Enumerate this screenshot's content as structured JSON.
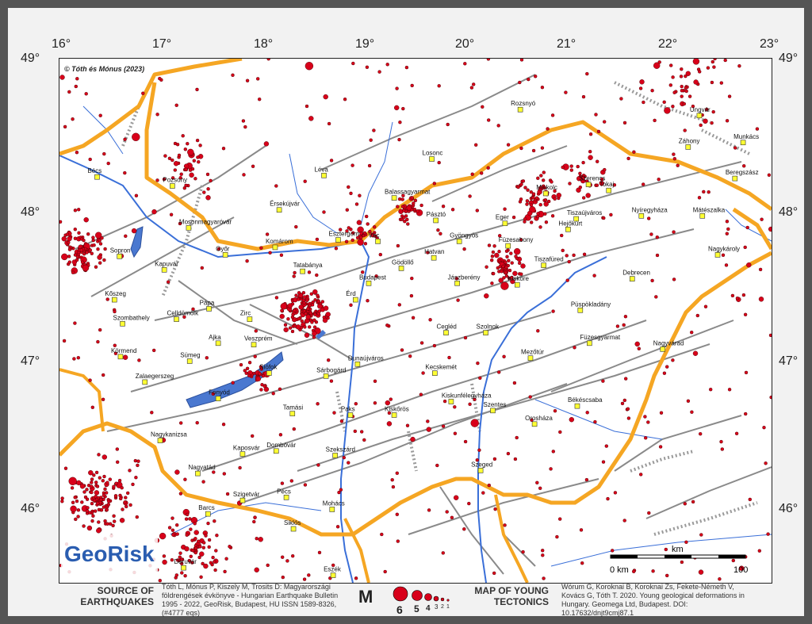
{
  "copyright": "© Tóth és Mónus (2023)",
  "lon_ticks": [
    "16°",
    "17°",
    "18°",
    "19°",
    "20°",
    "21°",
    "22°",
    "23°"
  ],
  "lat_ticks": [
    "49°",
    "48°",
    "47°",
    "46°"
  ],
  "logo": {
    "name": "GeoRisk",
    "tag": "Földrengéskutató Intézet • Earthquake Engineering • www.georisk.hu"
  },
  "towns": [
    {
      "name": "Rozsnyó",
      "lon": 20.53,
      "lat": 48.66
    },
    {
      "name": "Ungvár",
      "lon": 22.29,
      "lat": 48.62
    },
    {
      "name": "Losonc",
      "lon": 19.66,
      "lat": 48.33
    },
    {
      "name": "Munkács",
      "lon": 22.72,
      "lat": 48.44
    },
    {
      "name": "Záhony",
      "lon": 22.18,
      "lat": 48.41
    },
    {
      "name": "Léva",
      "lon": 18.6,
      "lat": 48.22
    },
    {
      "name": "Bécs",
      "lon": 16.37,
      "lat": 48.21
    },
    {
      "name": "Pozsony",
      "lon": 17.11,
      "lat": 48.15
    },
    {
      "name": "Szerencs",
      "lon": 21.2,
      "lat": 48.16
    },
    {
      "name": "Beregszász",
      "lon": 22.64,
      "lat": 48.2
    },
    {
      "name": "Balassagyarmat",
      "lon": 19.29,
      "lat": 48.07
    },
    {
      "name": "Miskolc",
      "lon": 20.78,
      "lat": 48.1
    },
    {
      "name": "Tokaj",
      "lon": 21.4,
      "lat": 48.12
    },
    {
      "name": "Érsekújvár",
      "lon": 18.16,
      "lat": 47.99
    },
    {
      "name": "Pásztó",
      "lon": 19.7,
      "lat": 47.92
    },
    {
      "name": "Eger",
      "lon": 20.38,
      "lat": 47.9
    },
    {
      "name": "Tiszaújváros",
      "lon": 21.08,
      "lat": 47.93
    },
    {
      "name": "Nyíregyháza",
      "lon": 21.72,
      "lat": 47.95
    },
    {
      "name": "Mátészalka",
      "lon": 22.32,
      "lat": 47.95
    },
    {
      "name": "Mosonmagyaróvár",
      "lon": 17.27,
      "lat": 47.87
    },
    {
      "name": "Hejőkürt",
      "lon": 21.0,
      "lat": 47.86
    },
    {
      "name": "Gyöngyös",
      "lon": 19.93,
      "lat": 47.78
    },
    {
      "name": "Füzesabony",
      "lon": 20.41,
      "lat": 47.75
    },
    {
      "name": "Esztergom",
      "lon": 18.74,
      "lat": 47.79
    },
    {
      "name": "Vác",
      "lon": 19.13,
      "lat": 47.78
    },
    {
      "name": "Győr",
      "lon": 17.63,
      "lat": 47.69
    },
    {
      "name": "Komárom",
      "lon": 18.12,
      "lat": 47.74
    },
    {
      "name": "Sopron",
      "lon": 16.59,
      "lat": 47.68
    },
    {
      "name": "Tatabánya",
      "lon": 18.39,
      "lat": 47.58
    },
    {
      "name": "Hatvan",
      "lon": 19.68,
      "lat": 47.67
    },
    {
      "name": "Tiszafüred",
      "lon": 20.76,
      "lat": 47.62
    },
    {
      "name": "Nagykároly",
      "lon": 22.47,
      "lat": 47.69
    },
    {
      "name": "Kapuvár",
      "lon": 17.03,
      "lat": 47.59
    },
    {
      "name": "Gödöllő",
      "lon": 19.36,
      "lat": 47.6
    },
    {
      "name": "Budapest",
      "lon": 19.04,
      "lat": 47.5
    },
    {
      "name": "Jászberény",
      "lon": 19.91,
      "lat": 47.5
    },
    {
      "name": "Kisköre",
      "lon": 20.5,
      "lat": 47.49
    },
    {
      "name": "Debrecen",
      "lon": 21.63,
      "lat": 47.53
    },
    {
      "name": "Kőszeg",
      "lon": 16.54,
      "lat": 47.39
    },
    {
      "name": "Pápa",
      "lon": 17.47,
      "lat": 47.33
    },
    {
      "name": "Zirc",
      "lon": 17.87,
      "lat": 47.26
    },
    {
      "name": "Celldömölk",
      "lon": 17.15,
      "lat": 47.26
    },
    {
      "name": "Püspökladány",
      "lon": 21.12,
      "lat": 47.32
    },
    {
      "name": "Érd",
      "lon": 18.91,
      "lat": 47.39
    },
    {
      "name": "Szombathely",
      "lon": 16.62,
      "lat": 47.23
    },
    {
      "name": "Ajka",
      "lon": 17.56,
      "lat": 47.1
    },
    {
      "name": "Cegléd",
      "lon": 19.8,
      "lat": 47.17
    },
    {
      "name": "Szolnok",
      "lon": 20.19,
      "lat": 47.17
    },
    {
      "name": "Füzesgyarmat",
      "lon": 21.21,
      "lat": 47.1
    },
    {
      "name": "Veszprém",
      "lon": 17.91,
      "lat": 47.09
    },
    {
      "name": "Körmend",
      "lon": 16.6,
      "lat": 47.01
    },
    {
      "name": "Sümeg",
      "lon": 17.28,
      "lat": 46.98
    },
    {
      "name": "Nagyvárad",
      "lon": 21.93,
      "lat": 47.06
    },
    {
      "name": "Dunaújváros",
      "lon": 18.93,
      "lat": 46.96
    },
    {
      "name": "Mezőtúr",
      "lon": 20.63,
      "lat": 47.0
    },
    {
      "name": "Siófok",
      "lon": 18.06,
      "lat": 46.9
    },
    {
      "name": "Sárbogárd",
      "lon": 18.62,
      "lat": 46.88
    },
    {
      "name": "Kecskemét",
      "lon": 19.69,
      "lat": 46.9
    },
    {
      "name": "Zalaegerszeg",
      "lon": 16.84,
      "lat": 46.84
    },
    {
      "name": "Kiskunfélegyháza",
      "lon": 19.85,
      "lat": 46.71
    },
    {
      "name": "Fonyód",
      "lon": 17.56,
      "lat": 46.73
    },
    {
      "name": "Békéscsaba",
      "lon": 21.09,
      "lat": 46.68
    },
    {
      "name": "Szentes",
      "lon": 20.26,
      "lat": 46.65
    },
    {
      "name": "Tamási",
      "lon": 18.29,
      "lat": 46.63
    },
    {
      "name": "Paks",
      "lon": 18.86,
      "lat": 46.62
    },
    {
      "name": "Kiskőrös",
      "lon": 19.29,
      "lat": 46.62
    },
    {
      "name": "Orosháza",
      "lon": 20.67,
      "lat": 46.56
    },
    {
      "name": "Nagykanizsa",
      "lon": 16.99,
      "lat": 46.45
    },
    {
      "name": "Kaposvár",
      "lon": 17.8,
      "lat": 46.36
    },
    {
      "name": "Dombóvár",
      "lon": 18.13,
      "lat": 46.38
    },
    {
      "name": "Szekszárd",
      "lon": 18.71,
      "lat": 46.35
    },
    {
      "name": "Szeged",
      "lon": 20.14,
      "lat": 46.25
    },
    {
      "name": "Nagyatád",
      "lon": 17.36,
      "lat": 46.23
    },
    {
      "name": "Szigetvár",
      "lon": 17.8,
      "lat": 46.05
    },
    {
      "name": "Pécs",
      "lon": 18.23,
      "lat": 46.07
    },
    {
      "name": "Mohács",
      "lon": 18.68,
      "lat": 45.99
    },
    {
      "name": "Barcs",
      "lon": 17.46,
      "lat": 45.96
    },
    {
      "name": "Siklós",
      "lon": 18.3,
      "lat": 45.86
    },
    {
      "name": "Daruvár",
      "lon": 17.22,
      "lat": 45.6
    },
    {
      "name": "Eszék",
      "lon": 18.69,
      "lat": 45.55
    }
  ],
  "scale": {
    "label_km": "km",
    "label_zero": "0 km",
    "label_end": "100"
  },
  "legend": {
    "source_title": "SOURCE OF EARTHQUAKES",
    "source_text": "Tóth L, Mónus P, Kiszely M, Trosits D: Magyarországi földrengések évkönyve - Hungarian Earthquake Bulletin 1995 - 2022, GeoRisk, Budapest, HU ISSN 1589-8326, (#4777 eqs)",
    "m_label": "M",
    "mags": [
      "6",
      "5",
      "4",
      "3",
      "2",
      "1"
    ],
    "tectonics_title": "MAP OF YOUNG TECTONICS",
    "tectonics_text": "Wórum G, Koroknai B, Koroknai Zs, Fekete-Németh V, Kovács G, Tóth T. 2020. Young geological deformations in Hungary. Geomega Ltd, Budapest. DOI: 10.17632/dnjt9cmj87.1"
  },
  "colors": {
    "border": "#f5a623",
    "quake": "#d8001a",
    "river": "#3a6fd8",
    "lake": "#4a78d0",
    "fault": "#8a8a8a",
    "town": "#ffff33"
  },
  "projection": {
    "lon_min": 16.0,
    "lon_max": 23.0,
    "lat_min": 45.5,
    "lat_max": 49.0
  }
}
